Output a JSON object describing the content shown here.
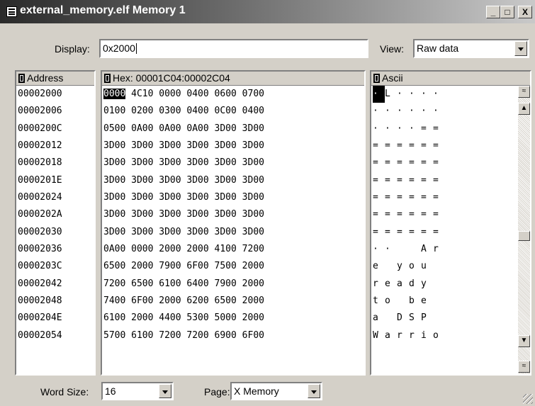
{
  "window": {
    "title": "external_memory.elf Memory 1",
    "min_label": "_",
    "max_label": "□",
    "close_label": "X"
  },
  "display": {
    "label": "Display:",
    "value": "0x2000"
  },
  "view": {
    "label": "View:",
    "value": "Raw data"
  },
  "address": {
    "header": "Address",
    "rows": [
      "00002000",
      "00002006",
      "0000200C",
      "00002012",
      "00002018",
      "0000201E",
      "00002024",
      "0000202A",
      "00002030",
      "00002036",
      "0000203C",
      "00002042",
      "00002048",
      "0000204E",
      "00002054"
    ]
  },
  "hex": {
    "header": "Hex: 00001C04:00002C04",
    "selected": "0000",
    "first_rest": " 4C10 0000 0400 0600 0700",
    "rows": [
      "",
      "0100 0200 0300 0400 0C00 0400",
      "0500 0A00 0A00 0A00 3D00 3D00",
      "3D00 3D00 3D00 3D00 3D00 3D00",
      "3D00 3D00 3D00 3D00 3D00 3D00",
      "3D00 3D00 3D00 3D00 3D00 3D00",
      "3D00 3D00 3D00 3D00 3D00 3D00",
      "3D00 3D00 3D00 3D00 3D00 3D00",
      "3D00 3D00 3D00 3D00 3D00 3D00",
      "0A00 0000 2000 2000 4100 7200",
      "6500 2000 7900 6F00 7500 2000",
      "7200 6500 6100 6400 7900 2000",
      "7400 6F00 2000 6200 6500 2000",
      "6100 2000 4400 5300 5000 2000",
      "5700 6100 7200 7200 6900 6F00"
    ]
  },
  "ascii": {
    "header": "Ascii",
    "rows": [
      [
        "·",
        "L",
        "·",
        "·",
        "·",
        "·"
      ],
      [
        "·",
        "·",
        "·",
        "·",
        "·",
        "·"
      ],
      [
        "·",
        "·",
        "·",
        "·",
        "=",
        "="
      ],
      [
        "=",
        "=",
        "=",
        "=",
        "=",
        "="
      ],
      [
        "=",
        "=",
        "=",
        "=",
        "=",
        "="
      ],
      [
        "=",
        "=",
        "=",
        "=",
        "=",
        "="
      ],
      [
        "=",
        "=",
        "=",
        "=",
        "=",
        "="
      ],
      [
        "=",
        "=",
        "=",
        "=",
        "=",
        "="
      ],
      [
        "=",
        "=",
        "=",
        "=",
        "=",
        "="
      ],
      [
        "·",
        "·",
        " ",
        " ",
        "A",
        "r"
      ],
      [
        "e",
        " ",
        "y",
        "o",
        "u",
        " "
      ],
      [
        "r",
        "e",
        "a",
        "d",
        "y",
        " "
      ],
      [
        "t",
        "o",
        " ",
        "b",
        "e",
        " "
      ],
      [
        "a",
        " ",
        "D",
        "S",
        "P",
        " "
      ],
      [
        "W",
        "a",
        "r",
        "r",
        "i",
        "o"
      ]
    ]
  },
  "word_size": {
    "label": "Word Size:",
    "value": "16"
  },
  "page": {
    "label": "Page:",
    "value": "X Memory"
  }
}
